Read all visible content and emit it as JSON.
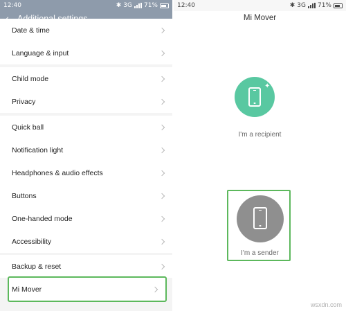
{
  "left": {
    "status": {
      "time": "12:40",
      "net": "3G",
      "battery": "71%"
    },
    "header": {
      "back_glyph": "‹",
      "title": "Additional settings"
    },
    "groups": [
      [
        "Date & time",
        "Language & input"
      ],
      [
        "Child mode",
        "Privacy"
      ],
      [
        "Quick ball",
        "Notification light",
        "Headphones & audio effects",
        "Buttons",
        "One-handed mode",
        "Accessibility"
      ],
      [
        "Backup & reset",
        "Mi Mover"
      ]
    ],
    "selected_item": "Mi Mover"
  },
  "right": {
    "status": {
      "time": "12:40",
      "net": "3G",
      "battery": "71%"
    },
    "title": "Mi Mover",
    "recipient_label": "I'm a recipient",
    "sender_label": "I'm a sender",
    "recipient_color": "#59c8a1",
    "sender_color": "#8f8f8f",
    "highlight_color": "#5cb85c"
  },
  "watermark": "wsxdn.com"
}
